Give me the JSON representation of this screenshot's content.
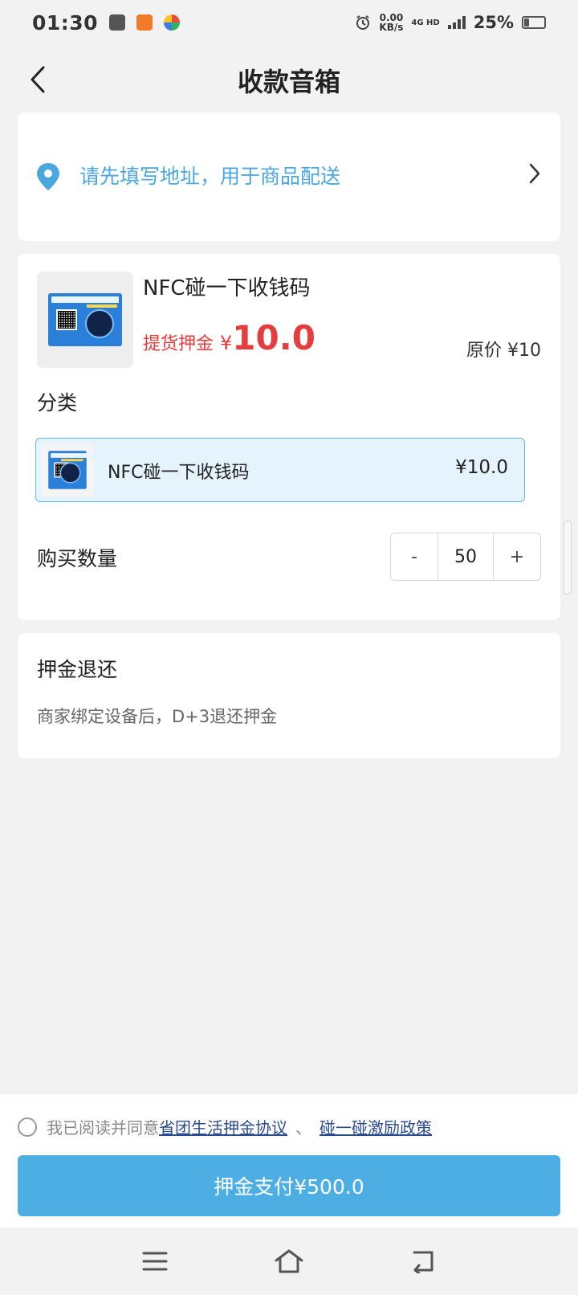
{
  "status_bar": {
    "time": "01:30",
    "speed_value": "0.00",
    "speed_unit": "KB/s",
    "network": "4G HD",
    "battery": "25%",
    "battery_level": 0.25
  },
  "header": {
    "title": "收款音箱"
  },
  "address": {
    "prompt": "请先填写地址，用于商品配送"
  },
  "product": {
    "name": "NFC碰一下收钱码",
    "deposit_label": "提货押金",
    "currency": "¥",
    "deposit_price": "10.0",
    "original_price": "原价 ¥10"
  },
  "category": {
    "title": "分类",
    "selected_name": "NFC碰一下收钱码",
    "selected_price": "¥10.0"
  },
  "quantity": {
    "title": "购买数量",
    "minus": "-",
    "value": "50",
    "plus": "+"
  },
  "refund": {
    "title": "押金退还",
    "description": "商家绑定设备后，D+3退还押金"
  },
  "agreement": {
    "prefix": "我已阅读并同意",
    "link1": "省团生活押金协议",
    "separator": "、",
    "link2": "碰一碰激励政策"
  },
  "pay_button": {
    "label": "押金支付¥500.0"
  },
  "colors": {
    "accent": "#4daee3",
    "price_red": "#e53d3d",
    "link_blue": "#2a4b8d",
    "address_blue": "#4aa8de"
  }
}
